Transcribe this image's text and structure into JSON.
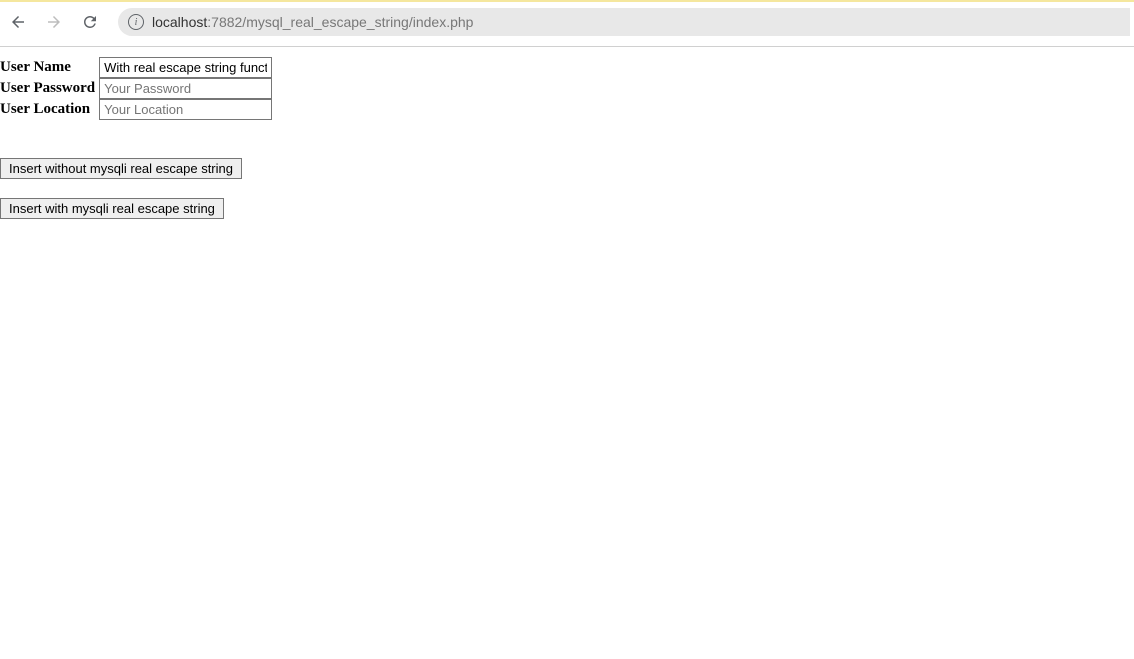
{
  "browser": {
    "url_prefix": "localhost",
    "url_suffix": ":7882/mysql_real_escape_string/index.php"
  },
  "form": {
    "username": {
      "label": "User Name",
      "value": "With real escape string function"
    },
    "password": {
      "label": "User Password",
      "placeholder": "Your Password",
      "value": ""
    },
    "location": {
      "label": "User Location",
      "placeholder": "Your Location",
      "value": ""
    }
  },
  "buttons": {
    "insert_without": "Insert without mysqli real escape string",
    "insert_with": "Insert with mysqli real escape string"
  }
}
